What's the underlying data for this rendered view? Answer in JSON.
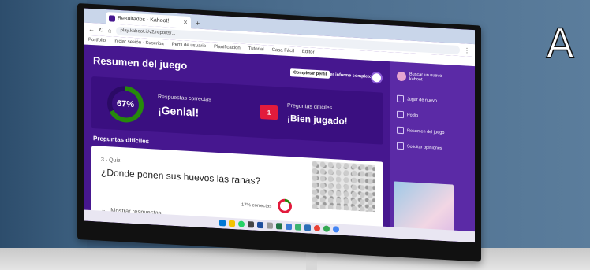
{
  "photo": {
    "label": "A"
  },
  "browser": {
    "tab_title": "Resultados - Kahoot!",
    "url": "play.kahoot.it/v2/reports/...",
    "bookmarks": [
      "Portfolio",
      "Iniciar sesión - Suscriba",
      "Perfil de usuario",
      "Planificación",
      "Tutorial",
      "Casa Fácil",
      "Editor"
    ]
  },
  "report": {
    "title": "Resumen del juego",
    "complete_button": "Completar perfil",
    "full_report_button": "Ver informe completo",
    "correct": {
      "percent": "67%",
      "percent_value": 67,
      "label": "Respuestas correctas",
      "headline": "¡Genial!"
    },
    "difficult": {
      "count": "1",
      "label": "Preguntas difíciles",
      "headline": "¡Bien jugado!"
    },
    "difficult_section_title": "Preguntas difíciles",
    "question_card": {
      "type": "3 - Quiz",
      "question": "¿Donde ponen sus huevos las ranas?",
      "correct_pct": "17% correctas",
      "correct_value": 17,
      "show_answers": "Mostrar respuestas"
    }
  },
  "sidebar": {
    "profile_text": "Buscar un nuevo kahoot",
    "items": [
      "Jugar de nuevo",
      "Podio",
      "Resumen del juego",
      "Solicitar opiniones"
    ]
  },
  "colors": {
    "kahoot_purple": "#46178f",
    "correct_green": "#26890c",
    "incorrect_red": "#e21b3c"
  }
}
